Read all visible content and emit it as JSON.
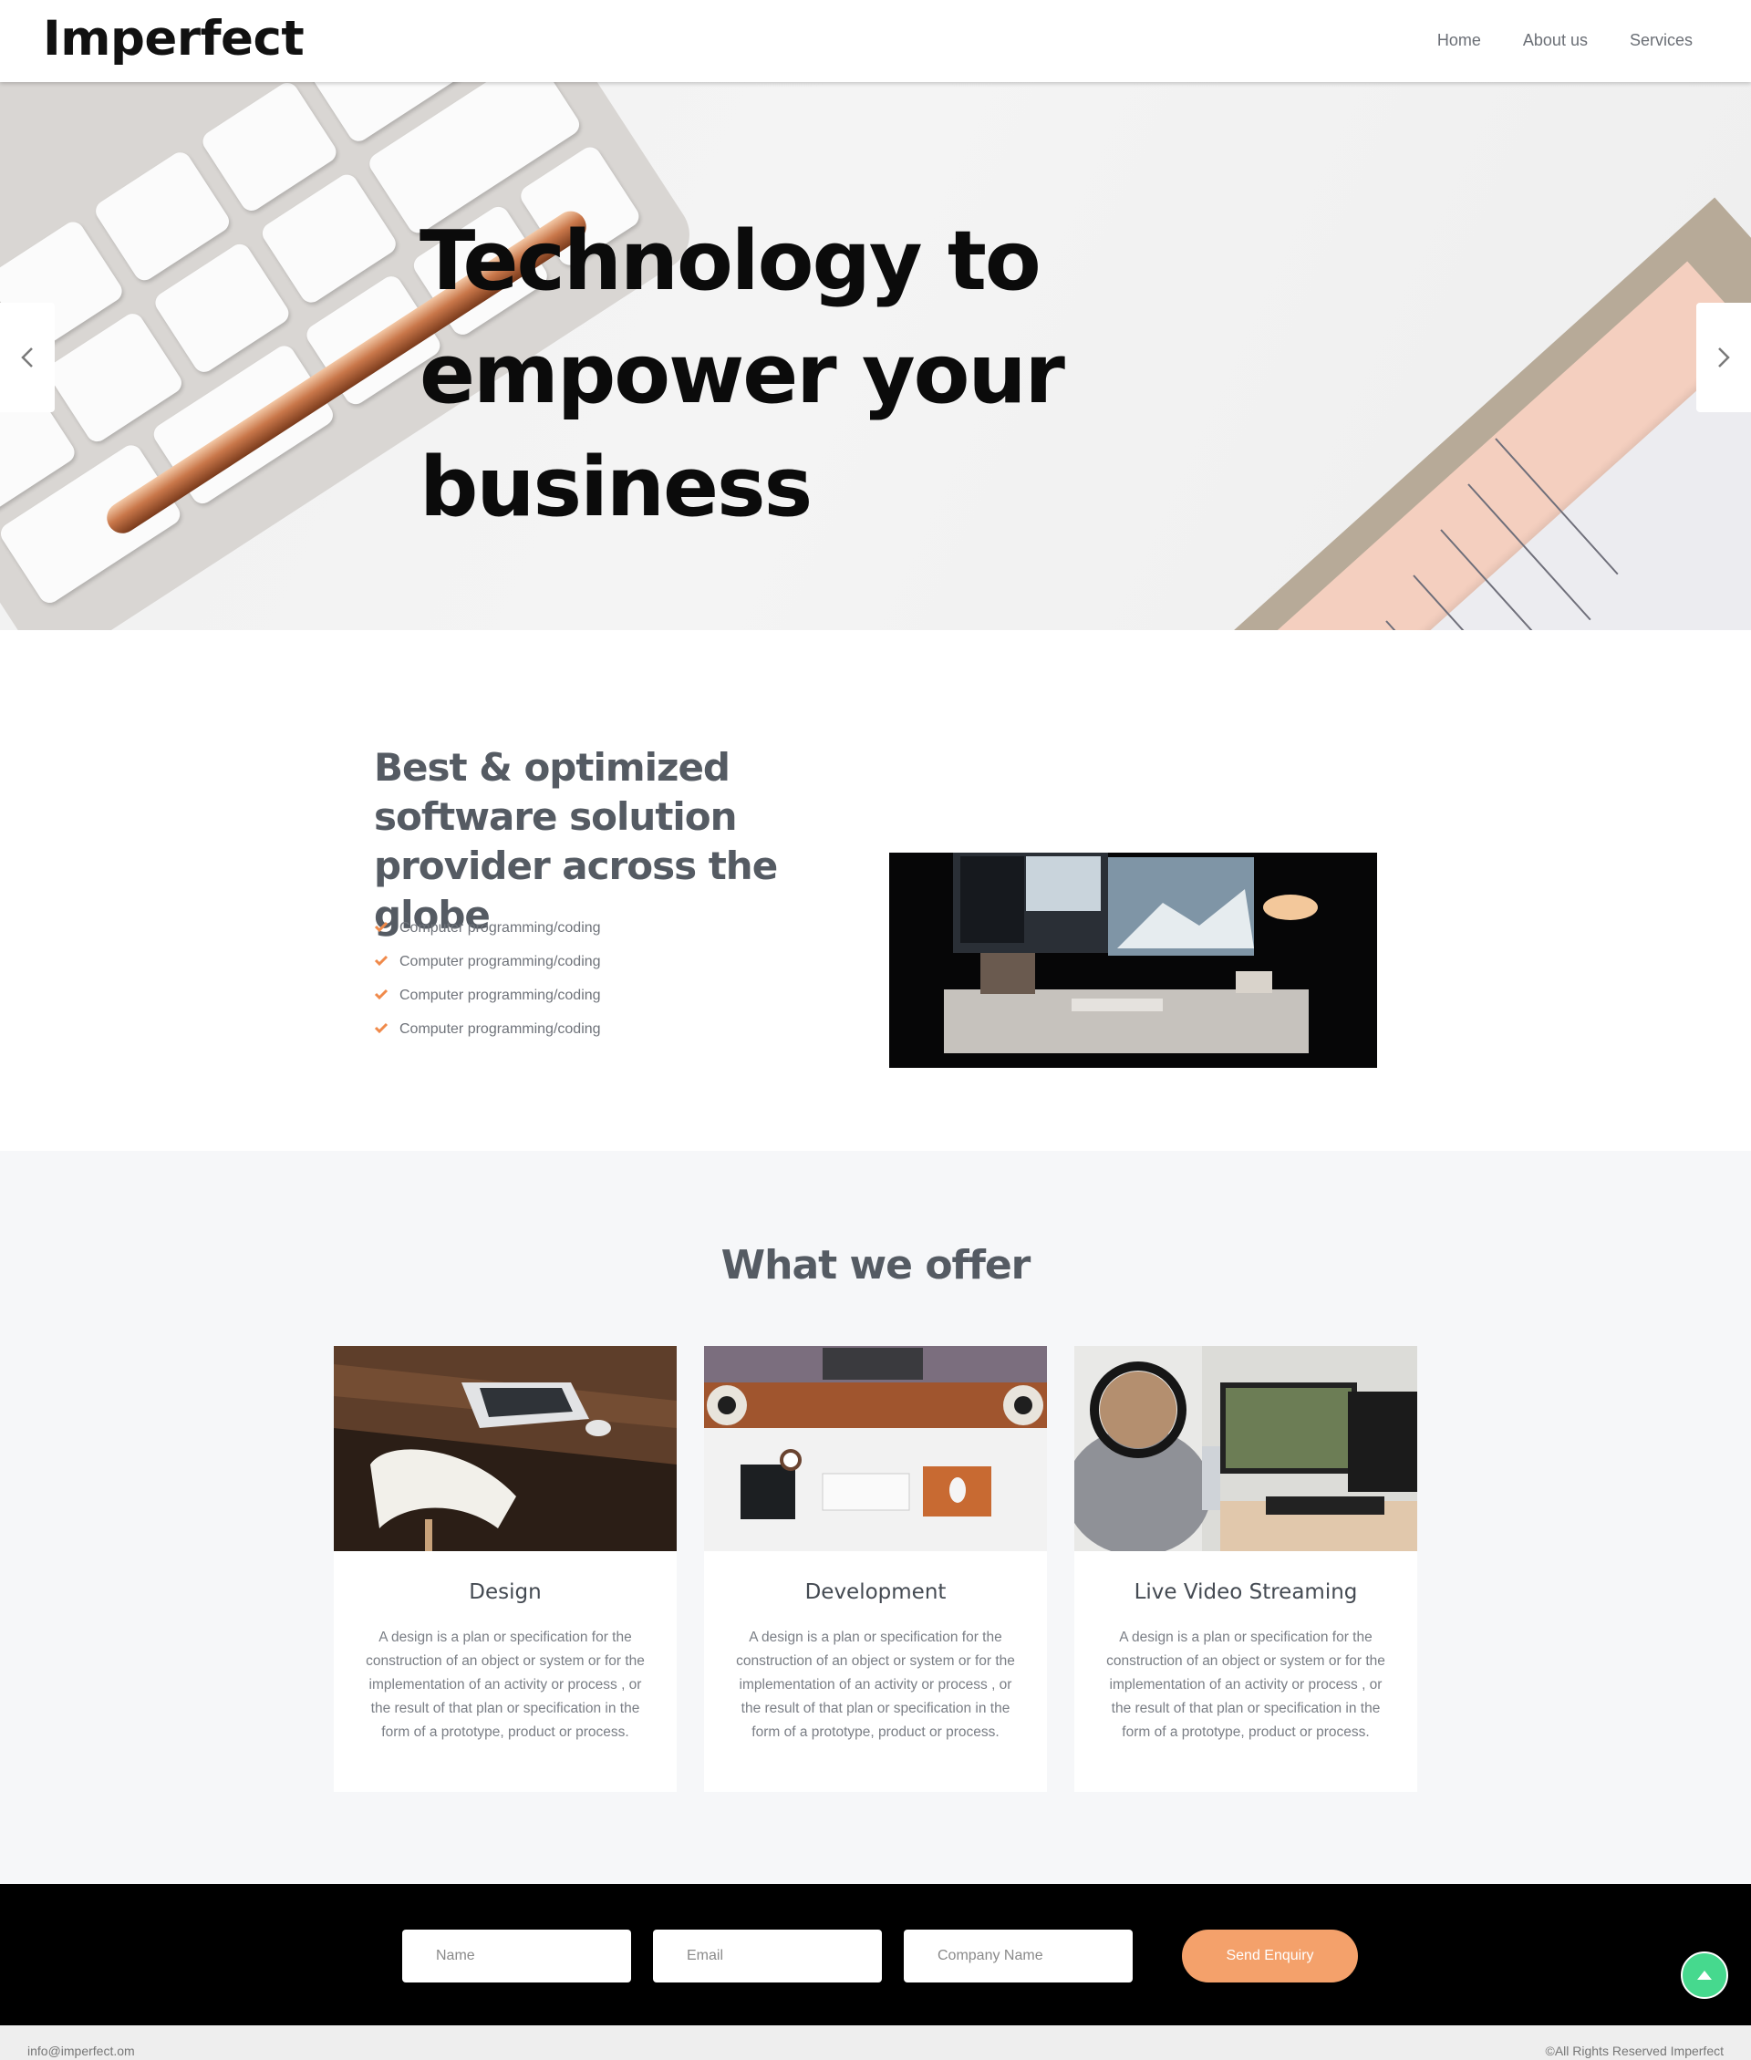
{
  "header": {
    "logo": "Imperfect",
    "nav": [
      "Home",
      "About us",
      "Services"
    ]
  },
  "hero": {
    "title": "Technology to empower your business",
    "prev_icon": "chevron-left-icon",
    "next_icon": "chevron-right-icon"
  },
  "about": {
    "title": "Best & optimized software solution provider across the globe",
    "features": [
      "Computer programming/coding",
      "Computer programming/coding",
      "Computer programming/coding",
      "Computer programming/coding"
    ],
    "check_icon": "check-icon",
    "accent": "#f08a4b"
  },
  "offer": {
    "title": "What we offer",
    "cards": [
      {
        "title": "Design",
        "desc": "A design is a plan or specification for the construction of an object or system or for the implementation of an activity or process , or the result of that plan or specification in the form of a prototype, product or process."
      },
      {
        "title": "Development",
        "desc": "A design is a plan or specification for the construction of an object or system or for the implementation of an activity or process , or the result of that plan or specification in the form of a prototype, product or process."
      },
      {
        "title": "Live Video Streaming",
        "desc": "A design is a plan or specification for the construction of an object or system or for the implementation of an activity or process , or the result of that plan or specification in the form of a prototype, product or process."
      }
    ]
  },
  "enquiry": {
    "name_placeholder": "Name",
    "email_placeholder": "Email",
    "company_placeholder": "Company Name",
    "send_label": "Send Enquiry",
    "button_color": "#f4a16b"
  },
  "scroll_top": {
    "icon": "arrow-up-icon",
    "color": "#46d98e"
  },
  "footer": {
    "email": "info@imperfect.om",
    "copyright": "©All Rights Reserved Imperfect"
  }
}
